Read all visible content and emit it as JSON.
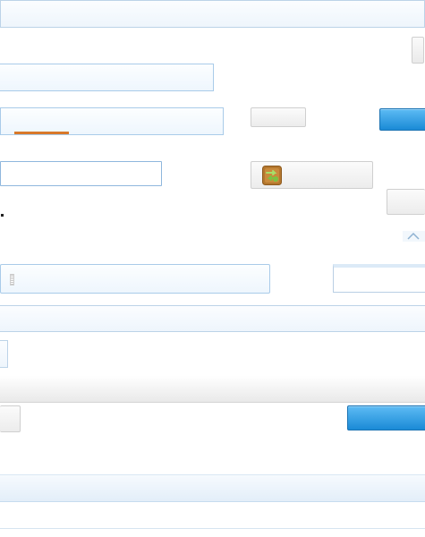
{
  "colors": {
    "accent_orange": "#d8792a",
    "button_blue": "#2a95dd",
    "field_border": "#a9cbe9",
    "icon_green": "#7cc142",
    "icon_brown": "#b4772e"
  },
  "icons": {
    "chevron": "chevron-up-icon",
    "app": "transfer-icon",
    "grip": "grip-icon"
  },
  "progress": {
    "tab_underline_fraction": 0.24
  }
}
